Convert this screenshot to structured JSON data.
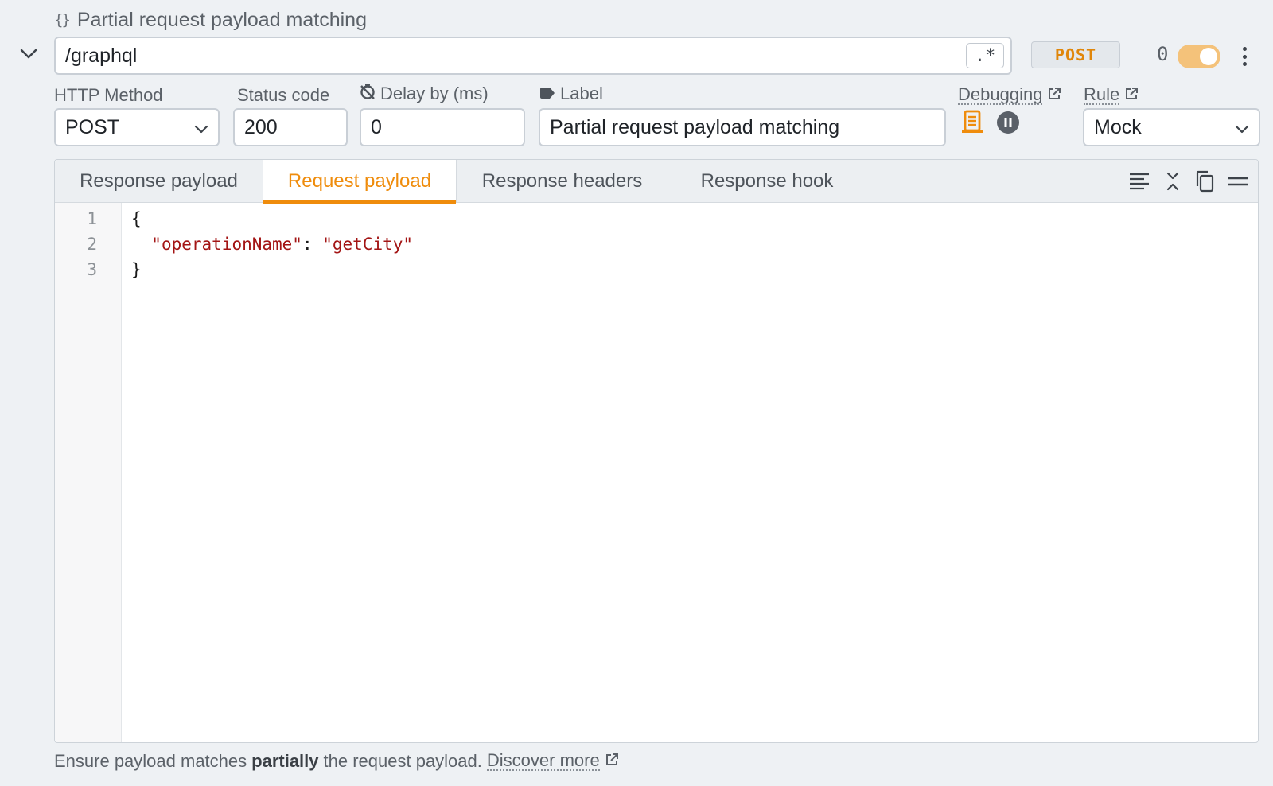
{
  "header": {
    "title": "Partial request payload matching",
    "url": "/graphql",
    "regex_label": ".*",
    "method_badge": "POST",
    "count": "0",
    "toggle_on": true
  },
  "fields": {
    "http_method_label": "HTTP Method",
    "http_method_value": "POST",
    "status_label": "Status code",
    "status_value": "200",
    "delay_label": "Delay by (ms)",
    "delay_value": "0",
    "label_label": "Label",
    "label_value": "Partial request payload matching",
    "debugging_label": "Debugging",
    "rule_label": "Rule",
    "rule_value": "Mock"
  },
  "tabs": [
    {
      "label": "Response payload",
      "active": false
    },
    {
      "label": "Request payload",
      "active": true
    },
    {
      "label": "Response headers",
      "active": false
    },
    {
      "label": "Response hook",
      "active": false
    }
  ],
  "editor": {
    "line_numbers": [
      "1",
      "2",
      "3"
    ],
    "lines": {
      "l1": "{",
      "l2_key": "\"operationName\"",
      "l2_sep": ": ",
      "l2_val": "\"getCity\"",
      "l3": "}"
    }
  },
  "footer": {
    "text_before": "Ensure payload matches",
    "text_bold": "partially",
    "text_after": "the request payload.",
    "link": "Discover more"
  },
  "colors": {
    "accent": "#ef8c0c",
    "toggle": "#f4c27a",
    "background": "#eef1f4"
  },
  "icons": [
    "braces-icon",
    "chevron-down-icon",
    "external-link-icon",
    "timer-off-icon",
    "tag-icon",
    "notes-icon",
    "pause-icon",
    "format-icon",
    "collapse-icon",
    "copy-icon",
    "menu-icon",
    "more-vertical-icon"
  ]
}
